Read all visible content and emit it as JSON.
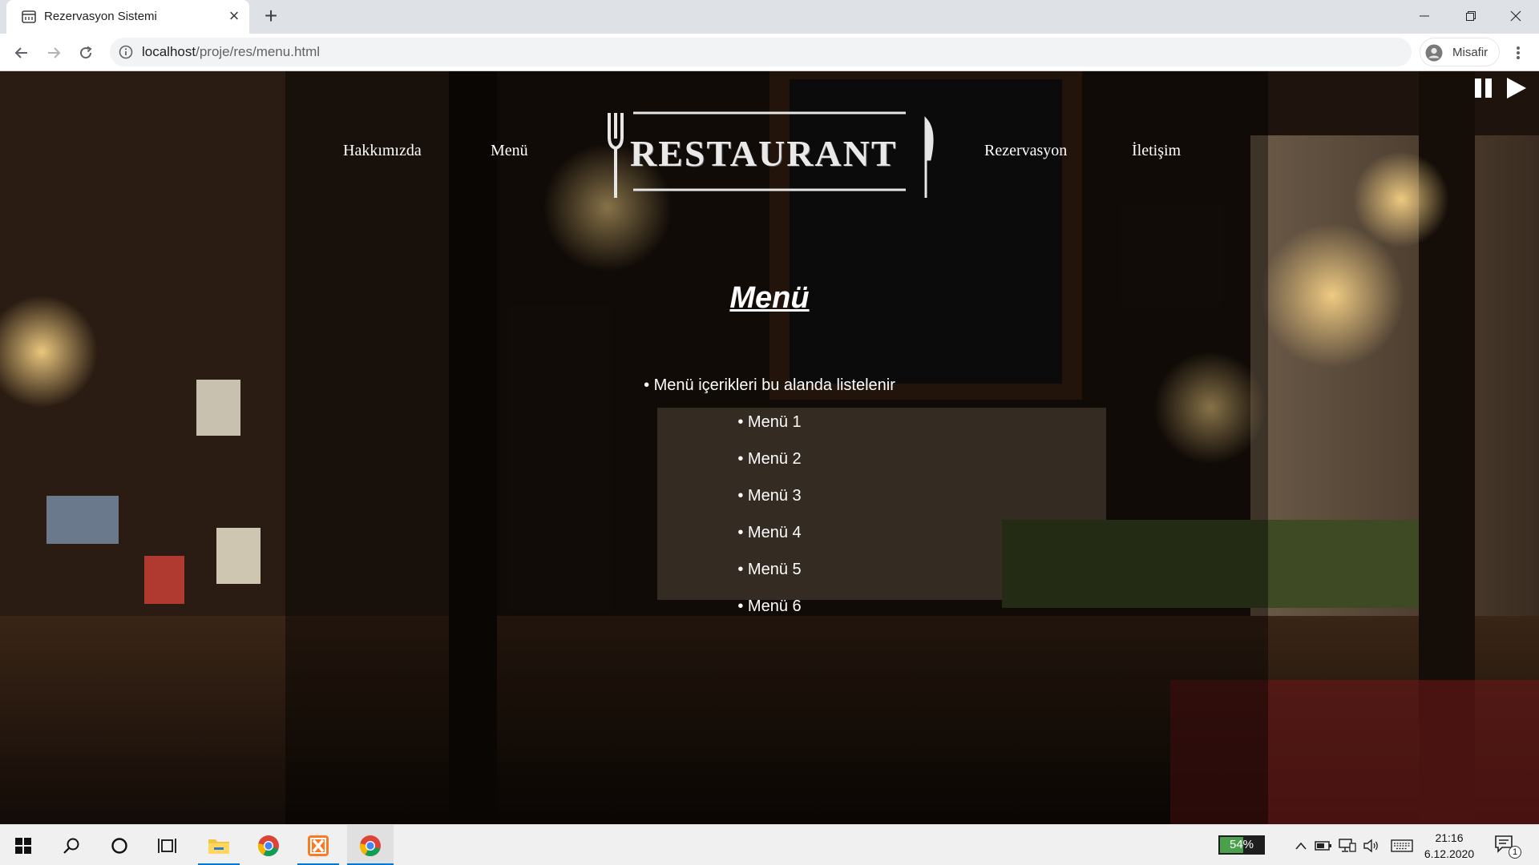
{
  "browser": {
    "tab_title": "Rezervasyon Sistemi",
    "url_host": "localhost",
    "url_path": "/proje/res/menu.html",
    "profile_label": "Misafir",
    "icons": [
      "restaurant-favicon",
      "close-icon",
      "plus-icon",
      "minimize-icon",
      "maximize-icon",
      "close-window-icon",
      "back-arrow-icon",
      "forward-arrow-icon",
      "reload-icon",
      "info-icon",
      "profile-avatar-icon",
      "kebab-menu-icon"
    ]
  },
  "site": {
    "nav": {
      "about": "Hakkımızda",
      "menu": "Menü",
      "reservation": "Rezervasyon",
      "contact": "İletişim"
    },
    "logo_text": "RESTAURANT",
    "media_controls": [
      "pause-icon",
      "play-icon"
    ],
    "page_title": "Menü",
    "menu_items": [
      "Menü içerikleri bu alanda listelenir",
      "Menü 1",
      "Menü 2",
      "Menü 3",
      "Menü 4",
      "Menü 5",
      "Menü 6"
    ]
  },
  "taskbar": {
    "battery_percent": "54%",
    "battery_level": 0.54,
    "time": "21:16",
    "date": "6.12.2020",
    "notification_count": "1",
    "apps": [
      "windows-start-icon",
      "search-icon",
      "cortana-icon",
      "task-view-icon",
      "file-explorer-icon",
      "chrome-icon",
      "xampp-icon",
      "chrome-icon"
    ],
    "accent_color": "#0078d7"
  }
}
